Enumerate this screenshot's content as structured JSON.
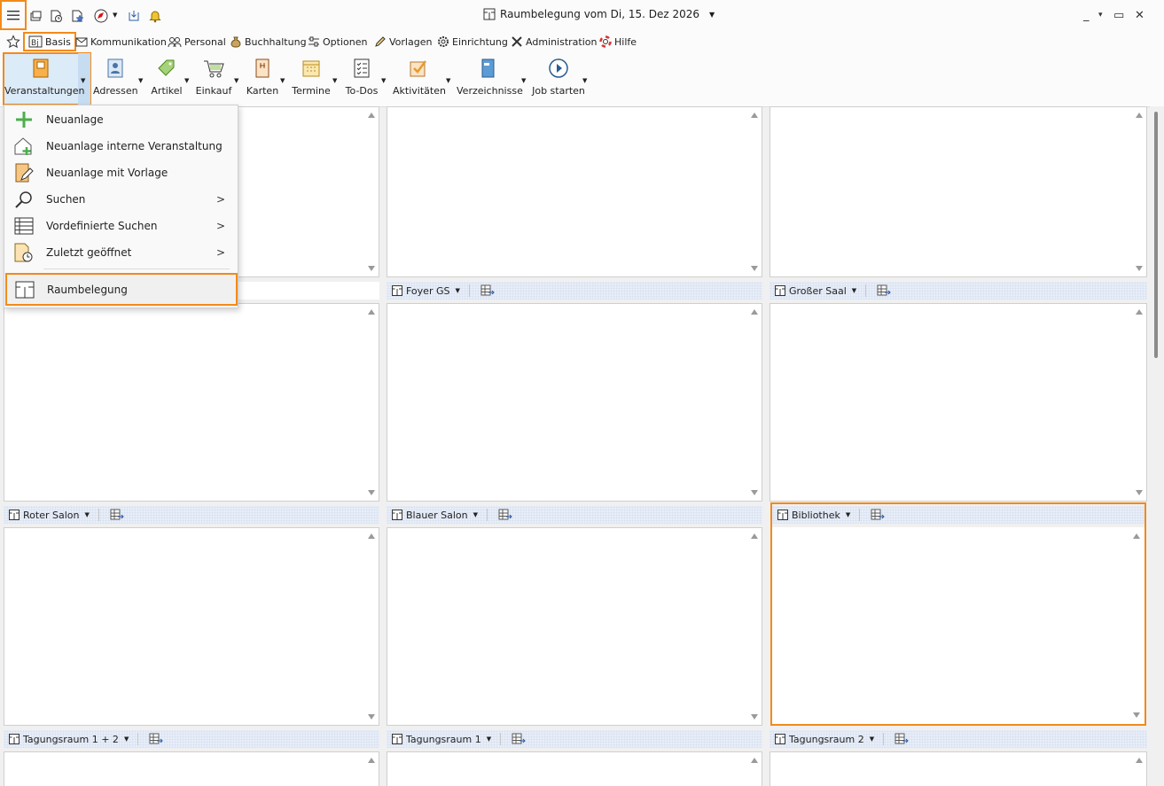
{
  "window": {
    "title": "Raumbelegung vom Di, 15. Dez 2026",
    "controls": {
      "minimize": "_",
      "menu": "▾",
      "maximize": "▭",
      "close": "✕"
    }
  },
  "quick_access": [
    "hamburger-menu-icon",
    "windows-icon",
    "recent-docs-icon",
    "favorites-star-icon",
    "navigation-compass-icon",
    "inbox-download-icon",
    "bell-icon"
  ],
  "tabs": [
    {
      "id": "favorites",
      "label": "",
      "icon": "star-icon"
    },
    {
      "id": "basis",
      "label": "Basis",
      "icon": "basis-icon"
    },
    {
      "id": "kommunikation",
      "label": "Kommunikation",
      "icon": "mail-icon"
    },
    {
      "id": "personal",
      "label": "Personal",
      "icon": "people-icon"
    },
    {
      "id": "buchhaltung",
      "label": "Buchhaltung",
      "icon": "money-bag-icon"
    },
    {
      "id": "optionen",
      "label": "Optionen",
      "icon": "sliders-icon"
    },
    {
      "id": "vorlagen",
      "label": "Vorlagen",
      "icon": "pencil-icon"
    },
    {
      "id": "einrichtung",
      "label": "Einrichtung",
      "icon": "gear-icon"
    },
    {
      "id": "administration",
      "label": "Administration",
      "icon": "tools-icon"
    },
    {
      "id": "hilfe",
      "label": "Hilfe",
      "icon": "lifebuoy-icon"
    }
  ],
  "ribbon": [
    {
      "id": "veranstaltungen",
      "label": "Veranstaltungen",
      "icon": "event-book-icon"
    },
    {
      "id": "adressen",
      "label": "Adressen",
      "icon": "address-card-icon"
    },
    {
      "id": "artikel",
      "label": "Artikel",
      "icon": "tag-icon"
    },
    {
      "id": "einkauf",
      "label": "Einkauf",
      "icon": "cart-icon"
    },
    {
      "id": "karten",
      "label": "Karten",
      "icon": "menu-card-icon"
    },
    {
      "id": "termine",
      "label": "Termine",
      "icon": "calendar-icon"
    },
    {
      "id": "todos",
      "label": "To-Dos",
      "icon": "checklist-icon"
    },
    {
      "id": "aktivitaeten",
      "label": "Aktivitäten",
      "icon": "activity-check-icon"
    },
    {
      "id": "verzeichnisse",
      "label": "Verzeichnisse",
      "icon": "binder-icon"
    },
    {
      "id": "job",
      "label": "Job starten",
      "icon": "play-icon"
    }
  ],
  "dropdown": [
    {
      "id": "neuanlage",
      "label": "Neuanlage",
      "icon": "plus-icon",
      "submenu": false
    },
    {
      "id": "neuanlage-intern",
      "label": "Neuanlage interne Veranstaltung",
      "icon": "house-plus-icon",
      "submenu": false
    },
    {
      "id": "neuanlage-vorlage",
      "label": "Neuanlage mit Vorlage",
      "icon": "template-edit-icon",
      "submenu": false
    },
    {
      "id": "suchen",
      "label": "Suchen",
      "icon": "magnifier-icon",
      "submenu": true
    },
    {
      "id": "vordef-suchen",
      "label": "Vordefinierte Suchen",
      "icon": "list-table-icon",
      "submenu": true
    },
    {
      "id": "zuletzt",
      "label": "Zuletzt geöffnet",
      "icon": "recent-doc-icon",
      "submenu": true
    },
    {
      "id": "raumbelegung",
      "label": "Raumbelegung",
      "icon": "room-plan-icon",
      "submenu": false
    }
  ],
  "rooms": [
    {
      "name": "Foyer GS"
    },
    {
      "name": "Großer Saal"
    },
    {
      "name": "Roter Salon"
    },
    {
      "name": "Blauer Salon"
    },
    {
      "name": "Bibliothek"
    },
    {
      "name": "Tagungsraum 1 + 2"
    },
    {
      "name": "Tagungsraum 1"
    },
    {
      "name": "Tagungsraum 2"
    }
  ],
  "colors": {
    "highlight": "#f28a1a",
    "accent": "#dcebf8",
    "header_band": "#e8eef8"
  }
}
